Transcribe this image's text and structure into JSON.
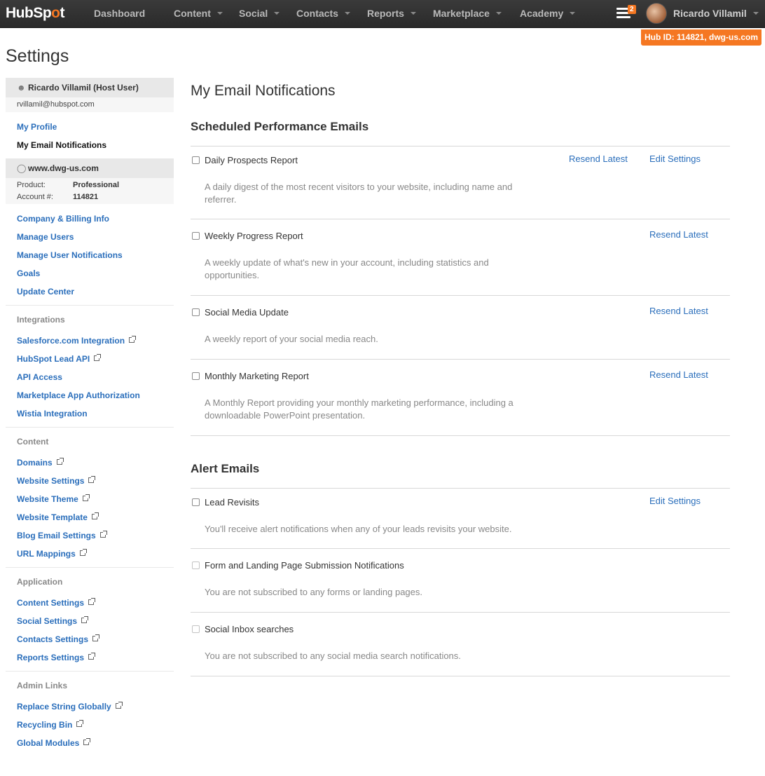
{
  "nav": {
    "logo_left": "HubSp",
    "logo_spot": "o",
    "logo_right": "t",
    "items": [
      "Dashboard",
      "Content",
      "Social",
      "Contacts",
      "Reports",
      "Marketplace",
      "Academy"
    ],
    "notif_count": "2",
    "user_name": "Ricardo Villamil",
    "hub_id": "Hub ID: 114821, dwg-us.com"
  },
  "page": {
    "title": "Settings"
  },
  "sidebar": {
    "user_header": "Ricardo Villamil (Host User)",
    "email": "rvillamil@hubspot.com",
    "user_links": [
      "My Profile",
      "My Email Notifications"
    ],
    "site_header": "www.dwg-us.com",
    "product_label": "Product:",
    "product_value": "Professional",
    "account_label": "Account #:",
    "account_value": "114821",
    "account_links": [
      "Company & Billing Info",
      "Manage Users",
      "Manage User Notifications",
      "Goals",
      "Update Center"
    ],
    "integrations_title": "Integrations",
    "integrations": [
      "Salesforce.com Integration",
      "HubSpot Lead API",
      "API Access",
      "Marketplace App Authorization",
      "Wistia Integration"
    ],
    "content_title": "Content",
    "content": [
      "Domains",
      "Website Settings",
      "Website Theme",
      "Website Template",
      "Blog Email Settings",
      "URL Mappings"
    ],
    "application_title": "Application",
    "application": [
      "Content Settings",
      "Social Settings",
      "Contacts Settings",
      "Reports Settings"
    ],
    "admin_title": "Admin Links",
    "admin": [
      "Replace String Globally",
      "Recycling Bin",
      "Global Modules"
    ]
  },
  "main": {
    "heading": "My Email Notifications",
    "scheduled_title": "Scheduled Performance Emails",
    "scheduled": [
      {
        "title": "Daily Prospects Report",
        "desc": "A daily digest of the most recent visitors to your website, including name and referrer.",
        "resend": "Resend Latest",
        "edit": "Edit Settings"
      },
      {
        "title": "Weekly Progress Report",
        "desc": "A weekly update of what's new in your account, including statistics and opportunities.",
        "resend": "Resend Latest"
      },
      {
        "title": "Social Media Update",
        "desc": "A weekly report of your social media reach.",
        "resend": "Resend Latest"
      },
      {
        "title": "Monthly Marketing Report",
        "desc": "A Monthly Report providing your monthly marketing performance, including a downloadable PowerPoint presentation.",
        "resend": "Resend Latest"
      }
    ],
    "alert_title": "Alert Emails",
    "alerts": [
      {
        "title": "Lead Revisits",
        "desc": "You'll receive alert notifications when any of your leads revisits your website.",
        "edit": "Edit Settings"
      },
      {
        "title": "Form and Landing Page Submission Notifications",
        "desc": "You are not subscribed to any forms or landing pages."
      },
      {
        "title": "Social Inbox searches",
        "desc": "You are not subscribed to any social media search notifications."
      }
    ]
  }
}
